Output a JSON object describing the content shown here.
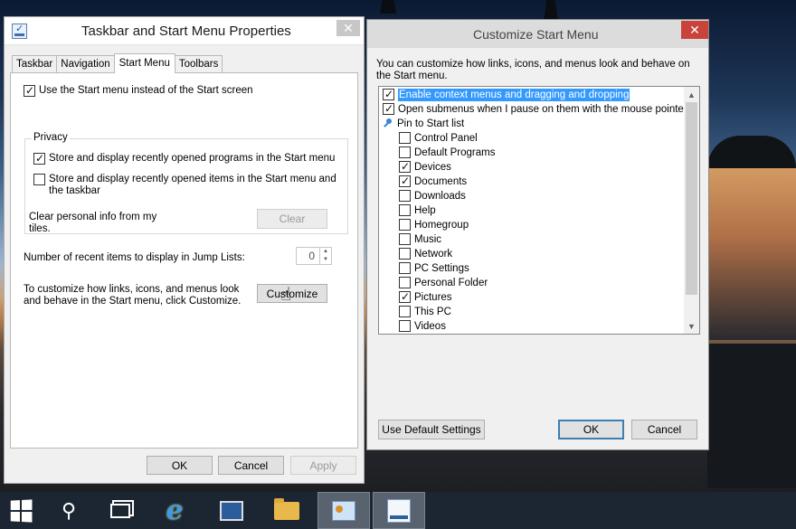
{
  "left_window": {
    "title": "Taskbar and Start Menu Properties",
    "close": "✕",
    "tabs": [
      "Taskbar",
      "Navigation",
      "Start Menu",
      "Toolbars"
    ],
    "active_tab": "Start Menu",
    "use_start_menu": {
      "label": "Use the Start menu instead of the Start screen",
      "checked": true
    },
    "privacy": {
      "legend": "Privacy",
      "store_programs": {
        "label": "Store and display recently opened programs in the Start menu",
        "checked": true
      },
      "store_items": {
        "label": "Store and display recently opened items in the Start menu and the taskbar",
        "checked": false
      },
      "clear_info": "Clear personal info from my tiles.",
      "clear_button": "Clear"
    },
    "jump_lists": {
      "label": "Number of recent items to display in Jump Lists:",
      "value": "0"
    },
    "customize_text": "To customize how links, icons, and menus look and behave in the Start menu, click Customize.",
    "customize_button": "Customize",
    "buttons": {
      "ok": "OK",
      "cancel": "Cancel",
      "apply": "Apply"
    }
  },
  "right_window": {
    "title": "Customize Start Menu",
    "close": "✕",
    "intro": "You can customize how links, icons, and menus look and behave on the Start menu.",
    "items": [
      {
        "label": "Enable context menus and dragging and dropping",
        "checked": true,
        "type": "check",
        "indent": 0,
        "selected": true
      },
      {
        "label": "Open submenus when I pause on them with the mouse pointer",
        "checked": true,
        "type": "check",
        "indent": 0
      },
      {
        "label": "Pin to Start list",
        "type": "group",
        "indent": 0
      },
      {
        "label": "Control Panel",
        "checked": false,
        "type": "check",
        "indent": 1
      },
      {
        "label": "Default Programs",
        "checked": false,
        "type": "check",
        "indent": 1
      },
      {
        "label": "Devices",
        "checked": true,
        "type": "check",
        "indent": 1
      },
      {
        "label": "Documents",
        "checked": true,
        "type": "check",
        "indent": 1
      },
      {
        "label": "Downloads",
        "checked": false,
        "type": "check",
        "indent": 1
      },
      {
        "label": "Help",
        "checked": false,
        "type": "check",
        "indent": 1
      },
      {
        "label": "Homegroup",
        "checked": false,
        "type": "check",
        "indent": 1
      },
      {
        "label": "Music",
        "checked": false,
        "type": "check",
        "indent": 1
      },
      {
        "label": "Network",
        "checked": false,
        "type": "check",
        "indent": 1
      },
      {
        "label": "PC Settings",
        "checked": false,
        "type": "check",
        "indent": 1
      },
      {
        "label": "Personal Folder",
        "checked": false,
        "type": "check",
        "indent": 1
      },
      {
        "label": "Pictures",
        "checked": true,
        "type": "check",
        "indent": 1
      },
      {
        "label": "This PC",
        "checked": false,
        "type": "check",
        "indent": 1
      },
      {
        "label": "Videos",
        "checked": false,
        "type": "check",
        "indent": 1
      }
    ],
    "buttons": {
      "defaults": "Use Default Settings",
      "ok": "OK",
      "cancel": "Cancel"
    }
  },
  "taskbar": {
    "items": [
      "start-icon",
      "search-icon",
      "task-view-icon",
      "internet-explorer-icon",
      "remote-desktop-icon",
      "file-explorer-icon",
      "control-panel-icon",
      "taskbar-properties-icon"
    ]
  },
  "colors": {
    "selection": "#3399ff",
    "close_red": "#c8433a",
    "taskbar": "#1c2633"
  }
}
